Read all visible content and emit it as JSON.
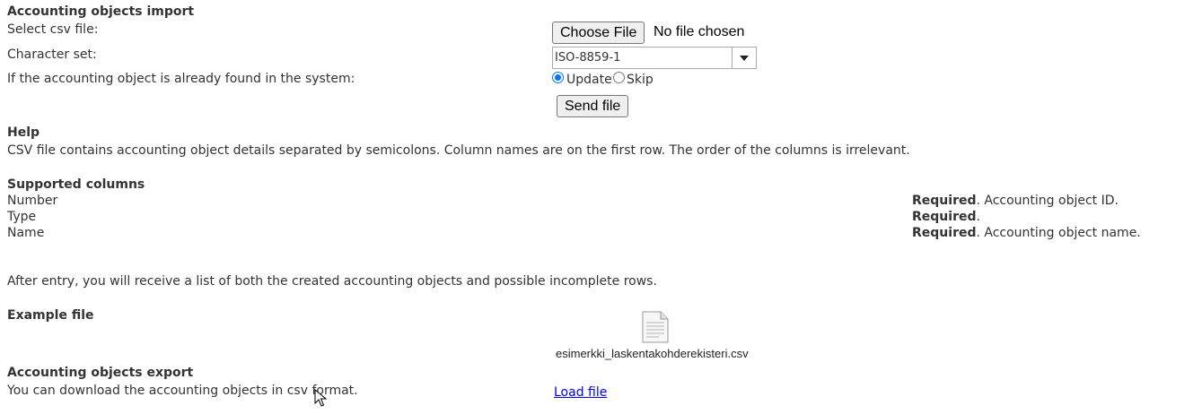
{
  "import": {
    "title": "Accounting objects import",
    "select_csv_label": "Select csv file:",
    "choose_file_button": "Choose File",
    "no_file_text": "No file chosen",
    "charset_label": "Character set:",
    "charset_value": "ISO-8859-1",
    "duplicate_label": "If the accounting object is already found in the system:",
    "options": [
      {
        "label": "Update",
        "checked": true
      },
      {
        "label": "Skip",
        "checked": false
      }
    ],
    "send_button": "Send file"
  },
  "help": {
    "title": "Help",
    "text": "CSV file contains accounting object details separated by semicolons. Column names are on the first row. The order of the columns is irrelevant."
  },
  "supported": {
    "title": "Supported columns",
    "rows": [
      {
        "name": "Number",
        "required": "Required",
        "desc": ". Accounting object ID."
      },
      {
        "name": "Type",
        "required": "Required",
        "desc": "."
      },
      {
        "name": "Name",
        "required": "Required",
        "desc": ". Accounting object name."
      }
    ]
  },
  "after_entry_text": "After entry, you will receive a list of both the created accounting objects and possible incomplete rows.",
  "example": {
    "title": "Example file",
    "file_icon": "document-icon",
    "filename": "esimerkki_laskentakohderekisteri.csv"
  },
  "export": {
    "title": "Accounting objects export",
    "text": "You can download the accounting objects in csv format.",
    "link": "Load file"
  }
}
